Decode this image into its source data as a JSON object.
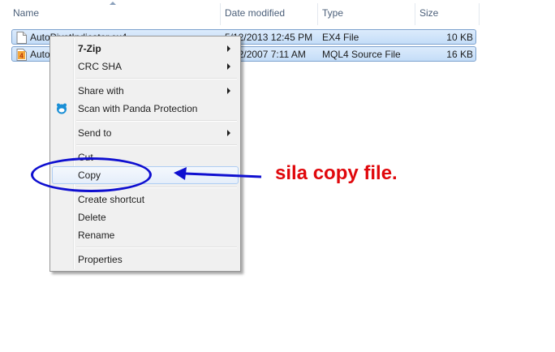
{
  "columns": {
    "name": "Name",
    "date": "Date modified",
    "type": "Type",
    "size": "Size"
  },
  "files": [
    {
      "name": "AutoPivotIndicator.ex4",
      "date": "5/12/2013 12:45 PM",
      "type": "EX4 File",
      "size": "10 KB",
      "icon": "document-icon"
    },
    {
      "name": "AutoPivotIndicator.mq4",
      "date": "2/12/2007 7:11 AM",
      "type": "MQL4 Source File",
      "size": "16 KB",
      "icon": "mql4-file-icon"
    }
  ],
  "context_menu": {
    "items": [
      {
        "label": "7-Zip",
        "bold": true,
        "submenu": true
      },
      {
        "label": "CRC SHA",
        "submenu": true
      },
      {
        "label": "Share with",
        "submenu": true
      },
      {
        "label": "Scan with Panda Protection",
        "icon": "panda-icon"
      },
      {
        "label": "Send to",
        "submenu": true
      },
      {
        "label": "Cut"
      },
      {
        "label": "Copy",
        "highlighted": true
      },
      {
        "label": "Create shortcut"
      },
      {
        "label": "Delete"
      },
      {
        "label": "Rename"
      },
      {
        "label": "Properties"
      }
    ]
  },
  "annotation": {
    "text": "sila copy file.",
    "color": "#e0080c",
    "ellipse_color": "#0f0fd0"
  }
}
